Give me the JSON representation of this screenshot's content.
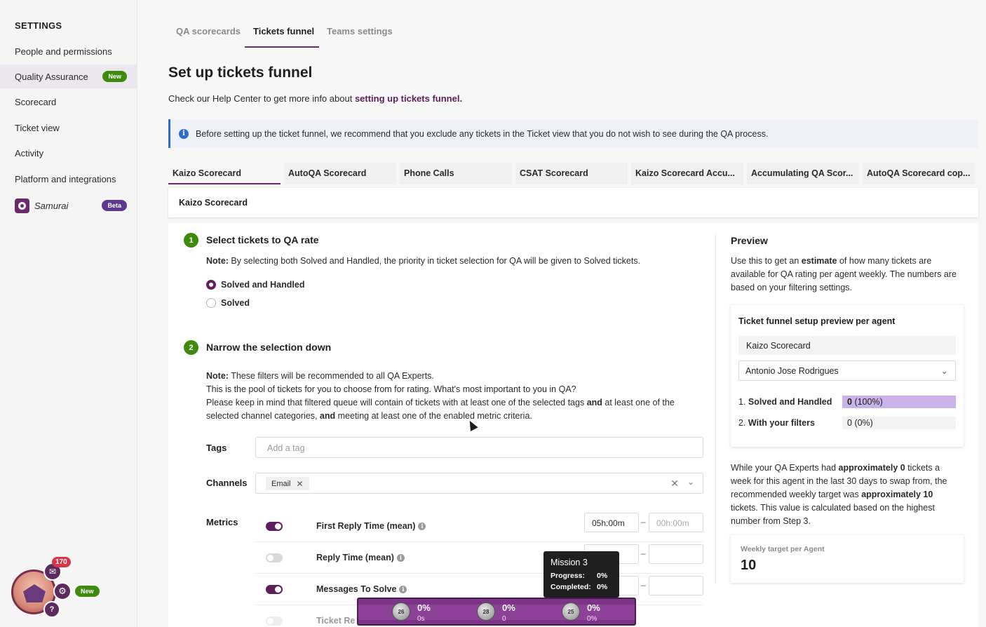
{
  "sidebar": {
    "title": "SETTINGS",
    "items": [
      {
        "label": "People and permissions"
      },
      {
        "label": "Quality Assurance",
        "badge": "New"
      },
      {
        "label": "Scorecard"
      },
      {
        "label": "Ticket view"
      },
      {
        "label": "Activity"
      },
      {
        "label": "Platform and integrations"
      },
      {
        "label": "Samurai",
        "badge": "Beta"
      }
    ]
  },
  "game": {
    "mail_count": "170",
    "new_badge": "New",
    "help": "?"
  },
  "top_tabs": [
    "QA scorecards",
    "Tickets funnel",
    "Teams settings"
  ],
  "page": {
    "title": "Set up tickets funnel",
    "help_text": "Check our Help Center to get more info about ",
    "help_link": "setting up tickets funnel.",
    "banner": "Before setting up the ticket funnel, we recommend that you exclude any tickets in the Ticket view that you do not wish to see during the QA process."
  },
  "scorecard_tabs": [
    "Kaizo Scorecard",
    "AutoQA Scorecard",
    "Phone Calls",
    "CSAT Scorecard",
    "Kaizo Scorecard Accu...",
    "Accumulating QA Scor...",
    "AutoQA Scorecard cop..."
  ],
  "panel_header": "Kaizo Scorecard",
  "step1": {
    "num": "1",
    "title": "Select tickets to QA rate",
    "note_bold": "Note:",
    "note": " By selecting both Solved and Handled, the priority in ticket selection for QA will be given to Solved tickets.",
    "options": [
      "Solved and Handled",
      "Solved"
    ]
  },
  "step2": {
    "num": "2",
    "title": "Narrow the selection down",
    "note_bold": "Note:",
    "note_l1": " These filters will be recommended to all QA Experts.",
    "note_l2": "This is the pool of tickets for you to choose from for rating. What's most important to you in QA?",
    "note_l3a": "Please keep in mind that filtered queue will contain of tickets with at least one of the selected tags ",
    "note_and1": "and",
    "note_l3b": " at least one of the",
    "note_l4a": "selected channel categories, ",
    "note_and2": "and",
    "note_l4b": " meeting at least one of the enabled metric criteria."
  },
  "filters": {
    "tags_label": "Tags",
    "tags_placeholder": "Add a tag",
    "channels_label": "Channels",
    "channel_chip": "Email",
    "metrics_label": "Metrics"
  },
  "metrics": [
    {
      "name": "First Reply Time (mean)",
      "enabled": true,
      "from": "05h:00m",
      "to": "00h:00m"
    },
    {
      "name": "Reply Time (mean)",
      "enabled": false,
      "from": "",
      "to": ""
    },
    {
      "name": "Messages To Solve",
      "enabled": true,
      "from": "",
      "to": ""
    },
    {
      "name": "Ticket Re",
      "enabled": false,
      "from": "",
      "to": ""
    }
  ],
  "preview": {
    "title": "Preview",
    "desc_a": "Use this to get an ",
    "desc_bold": "estimate",
    "desc_b": " of how many tickets are available for QA rating per agent weekly. The numbers are based on your filtering settings.",
    "card_title": "Ticket funnel setup preview per agent",
    "scorecard": "Kaizo Scorecard",
    "agent": "Antonio Jose Rodrigues",
    "row1_num": "1.",
    "row1_label": "Solved and Handled",
    "row1_value": "0",
    "row1_pct": "(100%)",
    "row2_num": "2.",
    "row2_label": "With your filters",
    "row2_value": "0",
    "row2_pct": "(0%)",
    "note_a": "While your QA Experts had ",
    "note_b1": "approximately 0",
    "note_c": " tickets a week for this agent in the last 30 days to swap from, the recommended weekly target was ",
    "note_b2": "approximately 10",
    "note_d": " tickets. This value is calculated based on the highest number from Step 3.",
    "weekly_label": "Weekly target per Agent",
    "weekly_value": "10"
  },
  "tooltip": {
    "title": "Mission 3",
    "progress_label": "Progress:",
    "progress": "0%",
    "completed_label": "Completed:",
    "completed": "0%"
  },
  "missions": [
    {
      "badge": "26",
      "pct": "0%",
      "sub": "0s"
    },
    {
      "badge": "28",
      "pct": "0%",
      "sub": "0"
    },
    {
      "badge": "25",
      "pct": "0%",
      "sub": "0%"
    }
  ]
}
